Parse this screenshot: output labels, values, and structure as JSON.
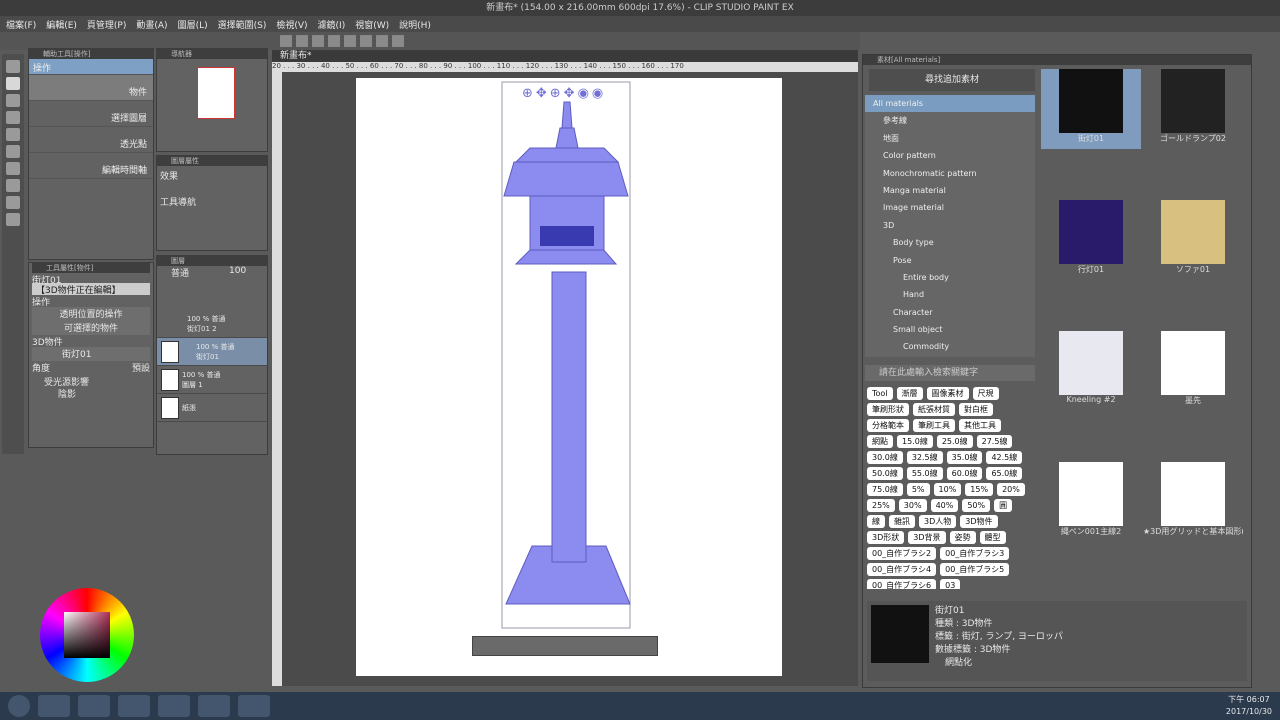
{
  "window": {
    "title": "新畫布* (154.00 x 216.00mm 600dpi 17.6%) - CLIP STUDIO PAINT EX"
  },
  "menu": [
    "檔案(F)",
    "編輯(E)",
    "頁管理(P)",
    "動畫(A)",
    "圖層(L)",
    "選擇範圍(S)",
    "檢視(V)",
    "濾鏡(I)",
    "視窗(W)",
    "說明(H)"
  ],
  "subtool": {
    "title": "輔助工具[操作]",
    "tab": "操作",
    "items": [
      "物件",
      "選擇圖層",
      "透光點",
      "編輯時間軸"
    ]
  },
  "tool_property": {
    "title": "工具屬性[物件]",
    "object": "街灯01",
    "banner": "【3D物件正在編輯】",
    "section": "操作",
    "item1": "透明位置的操作",
    "item2": "可選擇的物件",
    "obj_label": "3D物件",
    "obj_value": "街灯01",
    "angle": "角度",
    "preset": "預設",
    "light": "受光源影響",
    "shadow": "陰影"
  },
  "nav": {
    "title": "導航器"
  },
  "fx": {
    "title": "圖層屬性",
    "label": "效果",
    "nav": "工具導航"
  },
  "layers": {
    "title": "圖層",
    "blend": "普通",
    "opacity": "100",
    "rows": [
      {
        "n": "100 % 普通",
        "s": "街灯01 2"
      },
      {
        "n": "100 % 普通",
        "s": "街灯01"
      },
      {
        "n": "100 % 普通",
        "s": "圖層 1"
      },
      {
        "n": "",
        "s": "紙張"
      }
    ]
  },
  "canvas": {
    "tab": "新畫布*",
    "zoom": "17.6",
    "ruler": "20 . . . 30 . . . 40 . . . 50 . . . 60 . . . 70 . . . 80 . . . 90 . . . 100 . . . 110 . . . 120 . . . 130 . . . 140 . . . 150 . . . 160 . . . 170"
  },
  "materials": {
    "title": "素材[All materials]",
    "search": "尋找追加素材",
    "tree": [
      "All materials",
      "參考線",
      "地面",
      "Color pattern",
      "Monochromatic pattern",
      "Manga material",
      "Image material",
      "3D",
      "Body type",
      "Pose",
      "Entire body",
      "Hand",
      "Character",
      "Small object",
      "Commodity"
    ],
    "tag_placeholder": "請在此處輸入檢索關鍵字",
    "tags": [
      "Tool",
      "漸層",
      "圖像素材",
      "尺規",
      "筆刷形狀",
      "紙張材質",
      "對白框",
      "分格範本",
      "筆刷工具",
      "其他工具",
      "網點",
      "15.0線",
      "25.0線",
      "27.5線",
      "30.0線",
      "32.5線",
      "35.0線",
      "42.5線",
      "50.0線",
      "55.0線",
      "60.0線",
      "65.0線",
      "75.0線",
      "5%",
      "10%",
      "15%",
      "20%",
      "25%",
      "30%",
      "40%",
      "50%",
      "圓",
      "線",
      "雜訊",
      "3D人物",
      "3D物件",
      "3D形狀",
      "3D背景",
      "姿勢",
      "體型",
      "00_自作ブラシ2",
      "00_自作ブラシ3",
      "00_自作ブラシ4",
      "00_自作ブラシ5",
      "00_自作ブラシ6",
      "03"
    ],
    "items": [
      {
        "name": "街灯01"
      },
      {
        "name": "ゴールドランプ02"
      },
      {
        "name": "行灯01"
      },
      {
        "name": "ソファ01"
      },
      {
        "name": "Kneeling #2"
      },
      {
        "name": "墨先"
      },
      {
        "name": "縄ペン001主線2"
      },
      {
        "name": "★3D用グリッドと基本図形(v1.6.0)"
      }
    ],
    "detail": {
      "name": "街灯01",
      "kind": "種類 : 3D物件",
      "tag": "標籤 : 街灯, ランプ, ヨーロッパ",
      "count": "數據標籤 : 3D物件",
      "net": "網點化"
    }
  },
  "taskbar": {
    "time": "下午 06:07",
    "date": "2017/10/30"
  }
}
